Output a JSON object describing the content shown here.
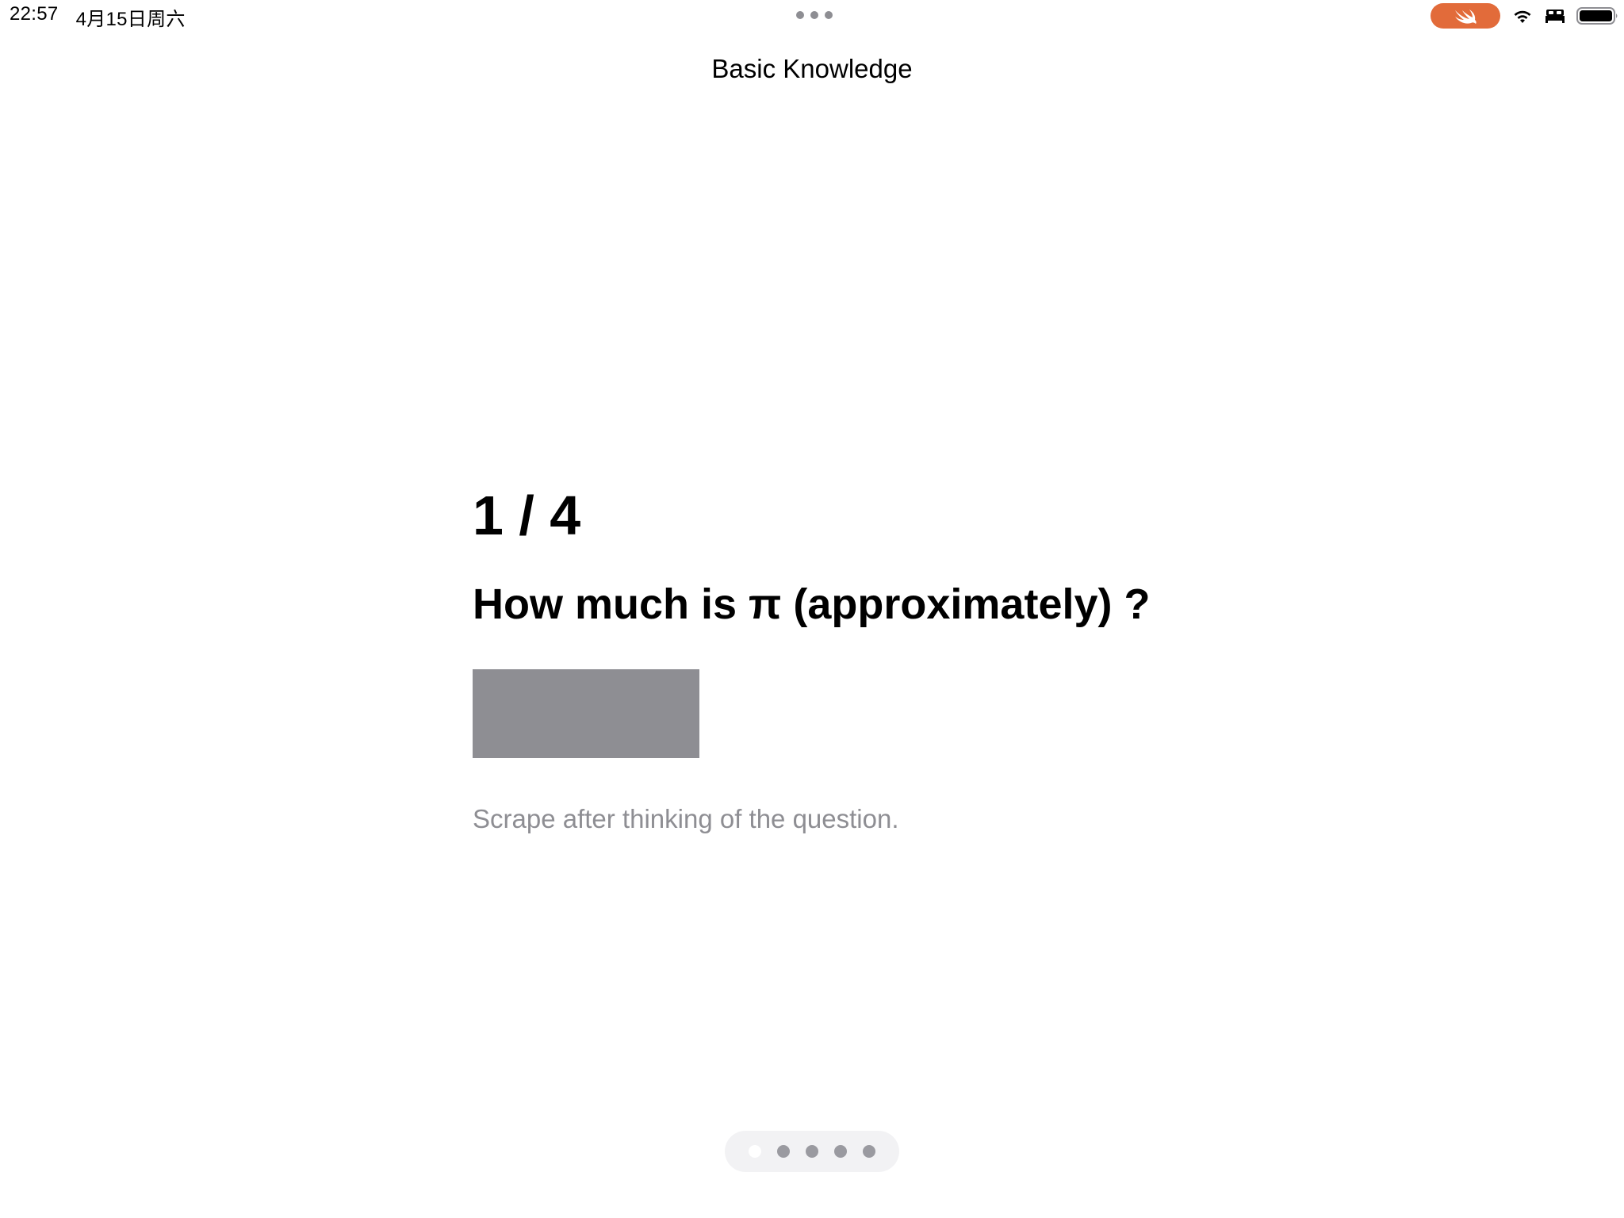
{
  "status_bar": {
    "time": "22:57",
    "date": "4月15日周六",
    "recording_color": "#e26b3a"
  },
  "nav": {
    "title": "Basic Knowledge"
  },
  "card": {
    "progress": "1 / 4",
    "question": "How much is π (approximately) ?",
    "scratch_color": "#8e8e93",
    "hint": "Scrape after thinking of the question."
  },
  "page_indicator": {
    "count": 5,
    "active_index": 0
  }
}
